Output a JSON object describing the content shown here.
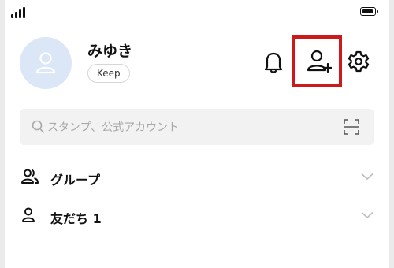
{
  "status_bar": {
    "signal_icon": "cellular-signal-icon",
    "battery_icon": "battery-icon"
  },
  "profile": {
    "name": "みゆき",
    "keep_label": "Keep",
    "avatar_icon": "default-avatar-icon"
  },
  "header_actions": {
    "notifications_icon": "bell-icon",
    "add_friend_icon": "add-friend-icon",
    "settings_icon": "gear-icon",
    "highlight_color": "#cc1a1a"
  },
  "search": {
    "placeholder": "スタンプ、公式アカウント",
    "search_icon": "search-icon",
    "scan_icon": "qr-scan-icon"
  },
  "sections": [
    {
      "label": "グループ",
      "icon": "group-icon"
    },
    {
      "label": "友だち 1",
      "icon": "person-icon"
    }
  ],
  "colors": {
    "avatar_bg": "#dbe6f7",
    "search_bg": "#f2f2f2"
  }
}
